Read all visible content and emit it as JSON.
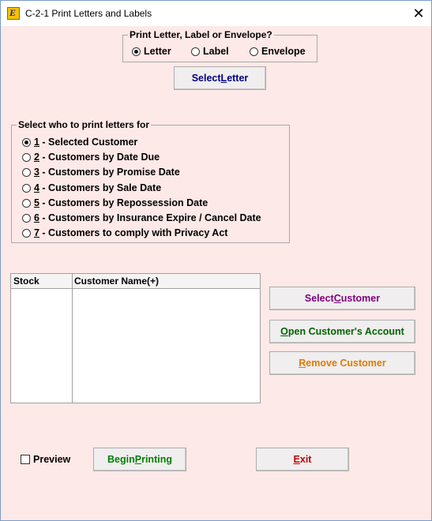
{
  "window": {
    "title": "C-2-1  Print Letters and Labels",
    "close_glyph": "✕",
    "icon_letter": "E"
  },
  "print_type": {
    "legend": "Print Letter, Label or Envelope?",
    "options": [
      {
        "label": "Letter",
        "selected": true
      },
      {
        "label": "Label",
        "selected": false
      },
      {
        "label": "Envelope",
        "selected": false
      }
    ]
  },
  "select_letter_button": {
    "pre": "Select ",
    "ul": "L",
    "post": "etter",
    "color": "#000080"
  },
  "who_group": {
    "legend": "Select who to print letters for",
    "options": [
      {
        "key": "1",
        "label": " - Selected Customer",
        "selected": true
      },
      {
        "key": "2",
        "label": " - Customers by Date Due",
        "selected": false
      },
      {
        "key": "3",
        "label": " - Customers by Promise Date",
        "selected": false
      },
      {
        "key": "4",
        "label": " - Customers by Sale Date",
        "selected": false
      },
      {
        "key": "5",
        "label": " - Customers by Repossession Date",
        "selected": false
      },
      {
        "key": "6",
        "label": " - Customers by Insurance Expire / Cancel Date",
        "selected": false
      },
      {
        "key": "7",
        "label": " - Customers to comply with Privacy Act",
        "selected": false
      }
    ]
  },
  "grid": {
    "columns": [
      "Stock",
      "Customer Name(+)"
    ],
    "rows": []
  },
  "side_buttons": {
    "select_customer": {
      "pre": "Select ",
      "ul": "C",
      "post": "ustomer",
      "color": "#800080"
    },
    "open_account": {
      "pre": "",
      "ul": "O",
      "post": "pen Customer's Account",
      "color": "#006400"
    },
    "remove_customer": {
      "pre": "",
      "ul": "R",
      "post": "emove Customer",
      "color": "#e07b00"
    }
  },
  "preview": {
    "label": "Preview",
    "checked": false
  },
  "begin_printing": {
    "pre": "Begin ",
    "ul": "P",
    "post": "rinting",
    "color": "#008000"
  },
  "exit_button": {
    "pre": "",
    "ul": "E",
    "post": "xit",
    "color": "#c00000"
  }
}
